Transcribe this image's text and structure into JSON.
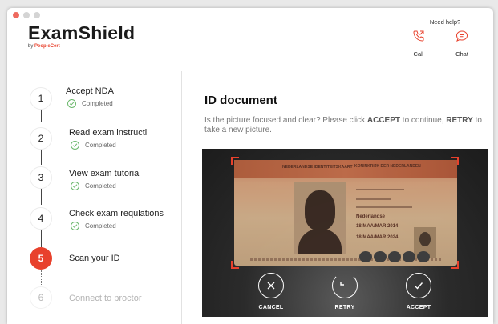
{
  "app": {
    "name": "ExamShield",
    "byline_prefix": "by ",
    "byline_brand": "PeopleCert",
    "brand_color": "#e8412c"
  },
  "help": {
    "title": "Need help?",
    "call_label": "Call",
    "chat_label": "Chat"
  },
  "steps": [
    {
      "number": "1",
      "label": "Accept NDA",
      "status": "Completed",
      "state": "done"
    },
    {
      "number": "2",
      "label": "Read exam instructi",
      "status": "Completed",
      "state": "done"
    },
    {
      "number": "3",
      "label": "View exam tutorial",
      "status": "Completed",
      "state": "done"
    },
    {
      "number": "4",
      "label": "Check exam requlations",
      "status": "Completed",
      "state": "done"
    },
    {
      "number": "5",
      "label": "Scan your ID",
      "state": "active"
    },
    {
      "number": "6",
      "label": "Connect to proctor",
      "state": "pending"
    }
  ],
  "main": {
    "title": "ID document",
    "desc_part1": "Is the picture focused and clear? Please click ",
    "desc_accept": "ACCEPT",
    "desc_part2": " to continue, ",
    "desc_retry": "RETRY",
    "desc_part3": " to take a new picture."
  },
  "id_card": {
    "header_left": "NEDERLANDSE IDENTITEITSKAART",
    "header_right": "KONINKRIJK DER NEDERLANDEN",
    "nationality": "Nederlandse",
    "issued": "18 MAA/MAR 2014",
    "expires": "18 MAA/MAR 2024"
  },
  "camera_actions": {
    "cancel": "CANCEL",
    "retry": "RETRY",
    "accept": "ACCEPT"
  }
}
